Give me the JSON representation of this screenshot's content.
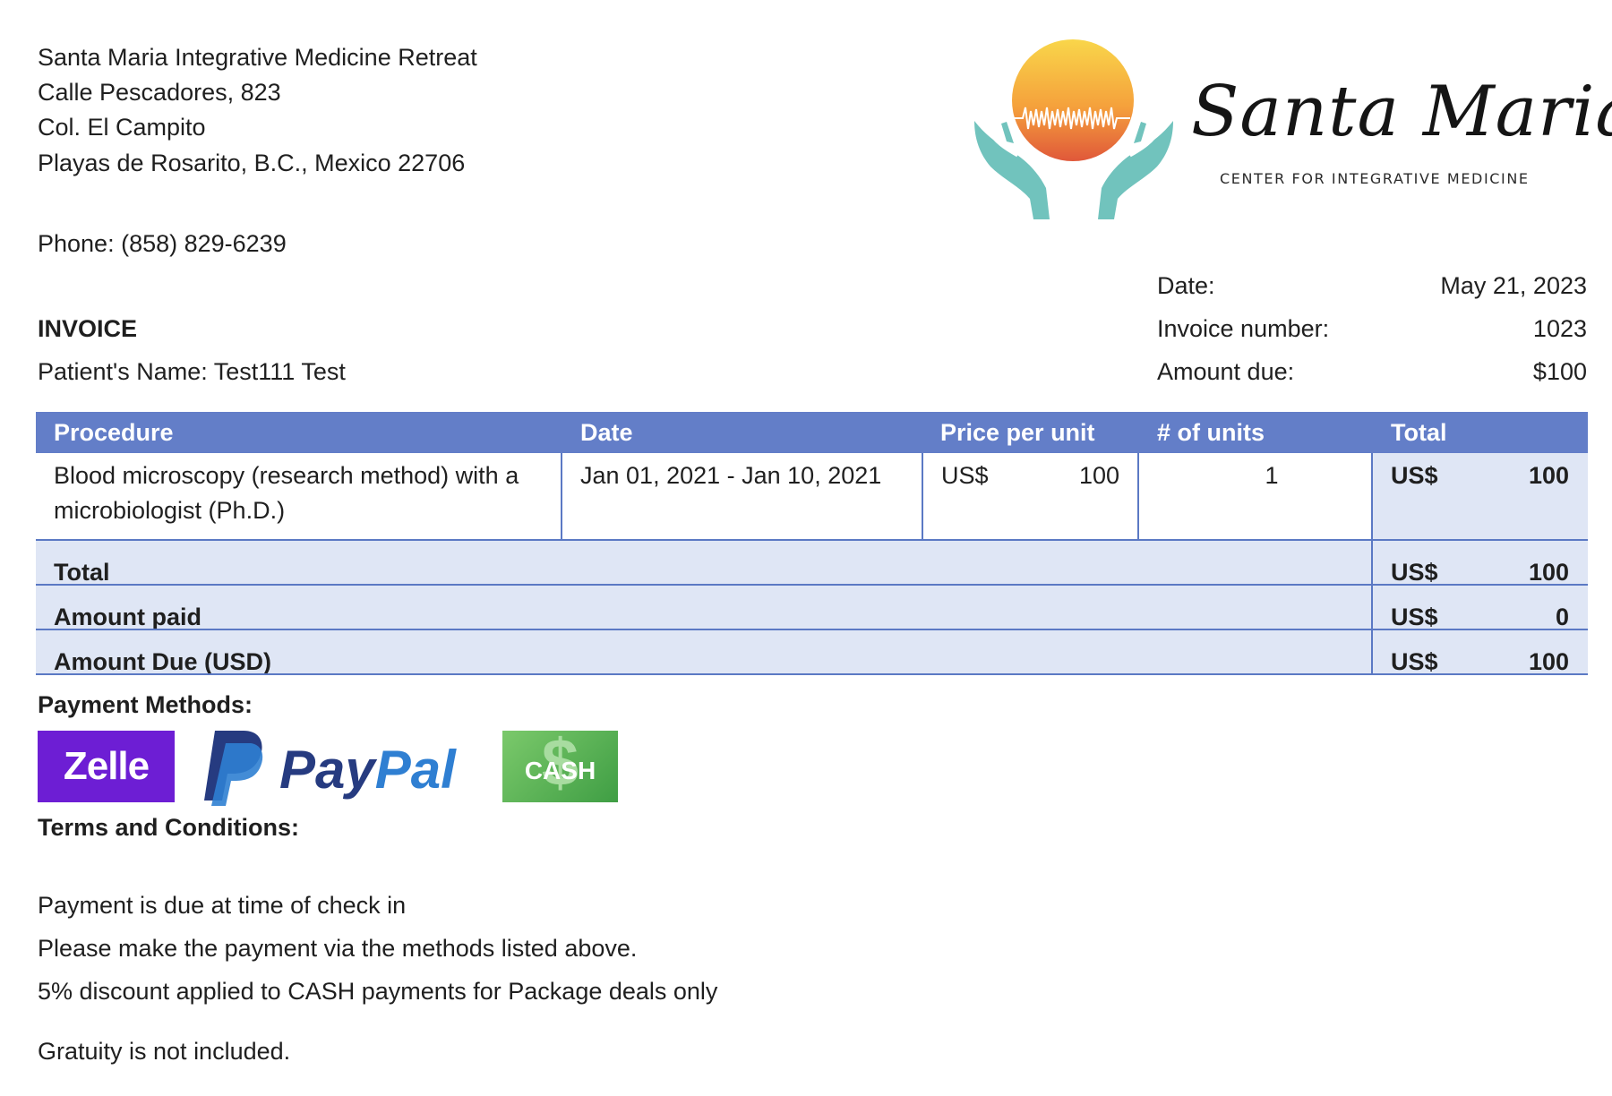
{
  "clinic": {
    "name": "Santa Maria Integrative Medicine Retreat",
    "street": "Calle Pescadores, 823",
    "colony": "Col. El Campito",
    "city": "Playas de Rosarito, B.C., Mexico 22706",
    "phone": "Phone: (858) 829-6239"
  },
  "logo": {
    "script_name": "Santa Maria",
    "subtitle": "CENTER FOR INTEGRATIVE MEDICINE"
  },
  "invoice": {
    "title": "INVOICE",
    "patient": "Patient's Name: Test111 Test",
    "date_label": "Date:",
    "date_value": "May 21, 2023",
    "number_label": "Invoice number:",
    "number_value": "1023",
    "due_label": "Amount due:",
    "due_value": "$100"
  },
  "table": {
    "headers": [
      "Procedure",
      "Date",
      "Price per unit",
      "# of units",
      "Total"
    ],
    "row": {
      "procedure_line1": "Blood microscopy (research method) with a",
      "procedure_line2": "microbiologist (Ph.D.)",
      "date": "Jan 01, 2021 - Jan 10, 2021",
      "price_currency": "US$",
      "price_amount": "100",
      "units": "1",
      "total_currency": "US$",
      "total_amount": "100"
    },
    "summary": [
      {
        "label": "Total",
        "currency": "US$",
        "amount": "100"
      },
      {
        "label": "Amount paid",
        "currency": "US$",
        "amount": "0"
      },
      {
        "label": "Amount Due (USD)",
        "currency": "US$",
        "amount": "100"
      }
    ]
  },
  "payment": {
    "heading": "Payment Methods:",
    "zelle": "Zelle",
    "paypal_pay": "Pay",
    "paypal_pal": "Pal",
    "cash": "CASH"
  },
  "terms": {
    "heading": "Terms and Conditions:",
    "line1": "Payment is due at time of check in",
    "line2": "Please make the payment via the methods listed above.",
    "line3": "5% discount applied to CASH payments for Package deals only",
    "line4": "Gratuity is not included."
  }
}
